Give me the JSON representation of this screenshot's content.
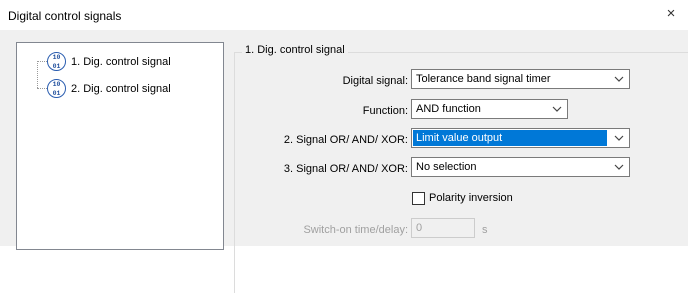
{
  "window": {
    "title": "Digital control signals",
    "close_glyph": "×"
  },
  "tree": {
    "items": [
      {
        "label": "1. Dig. control signal",
        "icon": "binary-signal-icon",
        "icon_text_top": "10",
        "icon_text_bottom": "01"
      },
      {
        "label": "2. Dig. control signal",
        "icon": "binary-signal-icon",
        "icon_text_top": "10",
        "icon_text_bottom": "01"
      }
    ]
  },
  "panel": {
    "group_title": "1. Dig. control signal",
    "digital_signal": {
      "label": "Digital signal:",
      "value": "Tolerance band signal timer"
    },
    "function": {
      "label": "Function:",
      "value": "AND function"
    },
    "signal2": {
      "label": "2. Signal OR/ AND/ XOR:",
      "value": "Limit value output"
    },
    "signal3": {
      "label": "3. Signal OR/ AND/ XOR:",
      "value": "No selection"
    },
    "polarity": {
      "label": "Polarity inversion",
      "checked": false
    },
    "switch_on": {
      "label": "Switch-on time/delay:",
      "value": "0",
      "unit": "s"
    }
  },
  "colors": {
    "selection": "#0078d7",
    "icon_blue": "#2a5db0"
  }
}
